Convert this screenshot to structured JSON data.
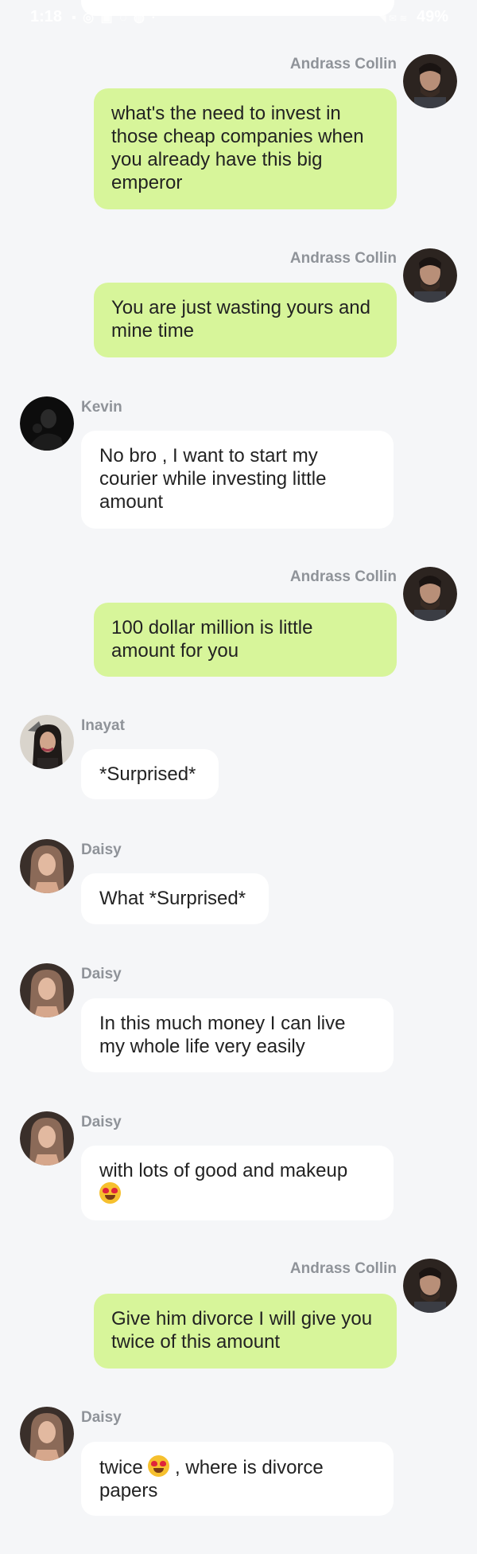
{
  "status_bar": {
    "time": "1:18",
    "notification_icons": "▪ ◎ ▣ ◌ ◍ ·",
    "network": "◥ ✉ ≋",
    "battery": "49%"
  },
  "messages": [
    {
      "id": "m1",
      "sender": "Andrass Collin",
      "direction": "out",
      "avatar": "andrass",
      "text": "what's the need to invest in those cheap companies when you already have this big emperor"
    },
    {
      "id": "m2",
      "sender": "Andrass Collin",
      "direction": "out",
      "avatar": "andrass",
      "text": "You are just wasting yours and mine time"
    },
    {
      "id": "m3",
      "sender": "Kevin",
      "direction": "in",
      "avatar": "kevin",
      "text": "No bro , I want to start my courier while investing little amount"
    },
    {
      "id": "m4",
      "sender": "Andrass Collin",
      "direction": "out",
      "avatar": "andrass",
      "text": "100 dollar million is little amount for you"
    },
    {
      "id": "m5",
      "sender": "Inayat",
      "direction": "in",
      "avatar": "inayat",
      "text": "*Surprised*"
    },
    {
      "id": "m6",
      "sender": "Daisy",
      "direction": "in",
      "avatar": "daisy",
      "text": "What *Surprised*"
    },
    {
      "id": "m7",
      "sender": "Daisy",
      "direction": "in",
      "avatar": "daisy",
      "text": "In this much money I can live my whole life very easily"
    },
    {
      "id": "m8",
      "sender": "Daisy",
      "direction": "in",
      "avatar": "daisy",
      "text": "with lots of good and makeup",
      "emoji_after": "heart-eyes"
    },
    {
      "id": "m9",
      "sender": "Andrass Collin",
      "direction": "out",
      "avatar": "andrass",
      "text": "Give him divorce I will give you twice of this amount"
    },
    {
      "id": "m10",
      "sender": "Daisy",
      "direction": "in",
      "avatar": "daisy",
      "text_before": "twice",
      "emoji_inline": "heart-eyes",
      "text_after": " , where is divorce papers"
    }
  ],
  "colors": {
    "background": "#f5f6f8",
    "outgoing_bubble": "#d7f59a",
    "incoming_bubble": "#ffffff",
    "sender_name": "#8f9399"
  }
}
